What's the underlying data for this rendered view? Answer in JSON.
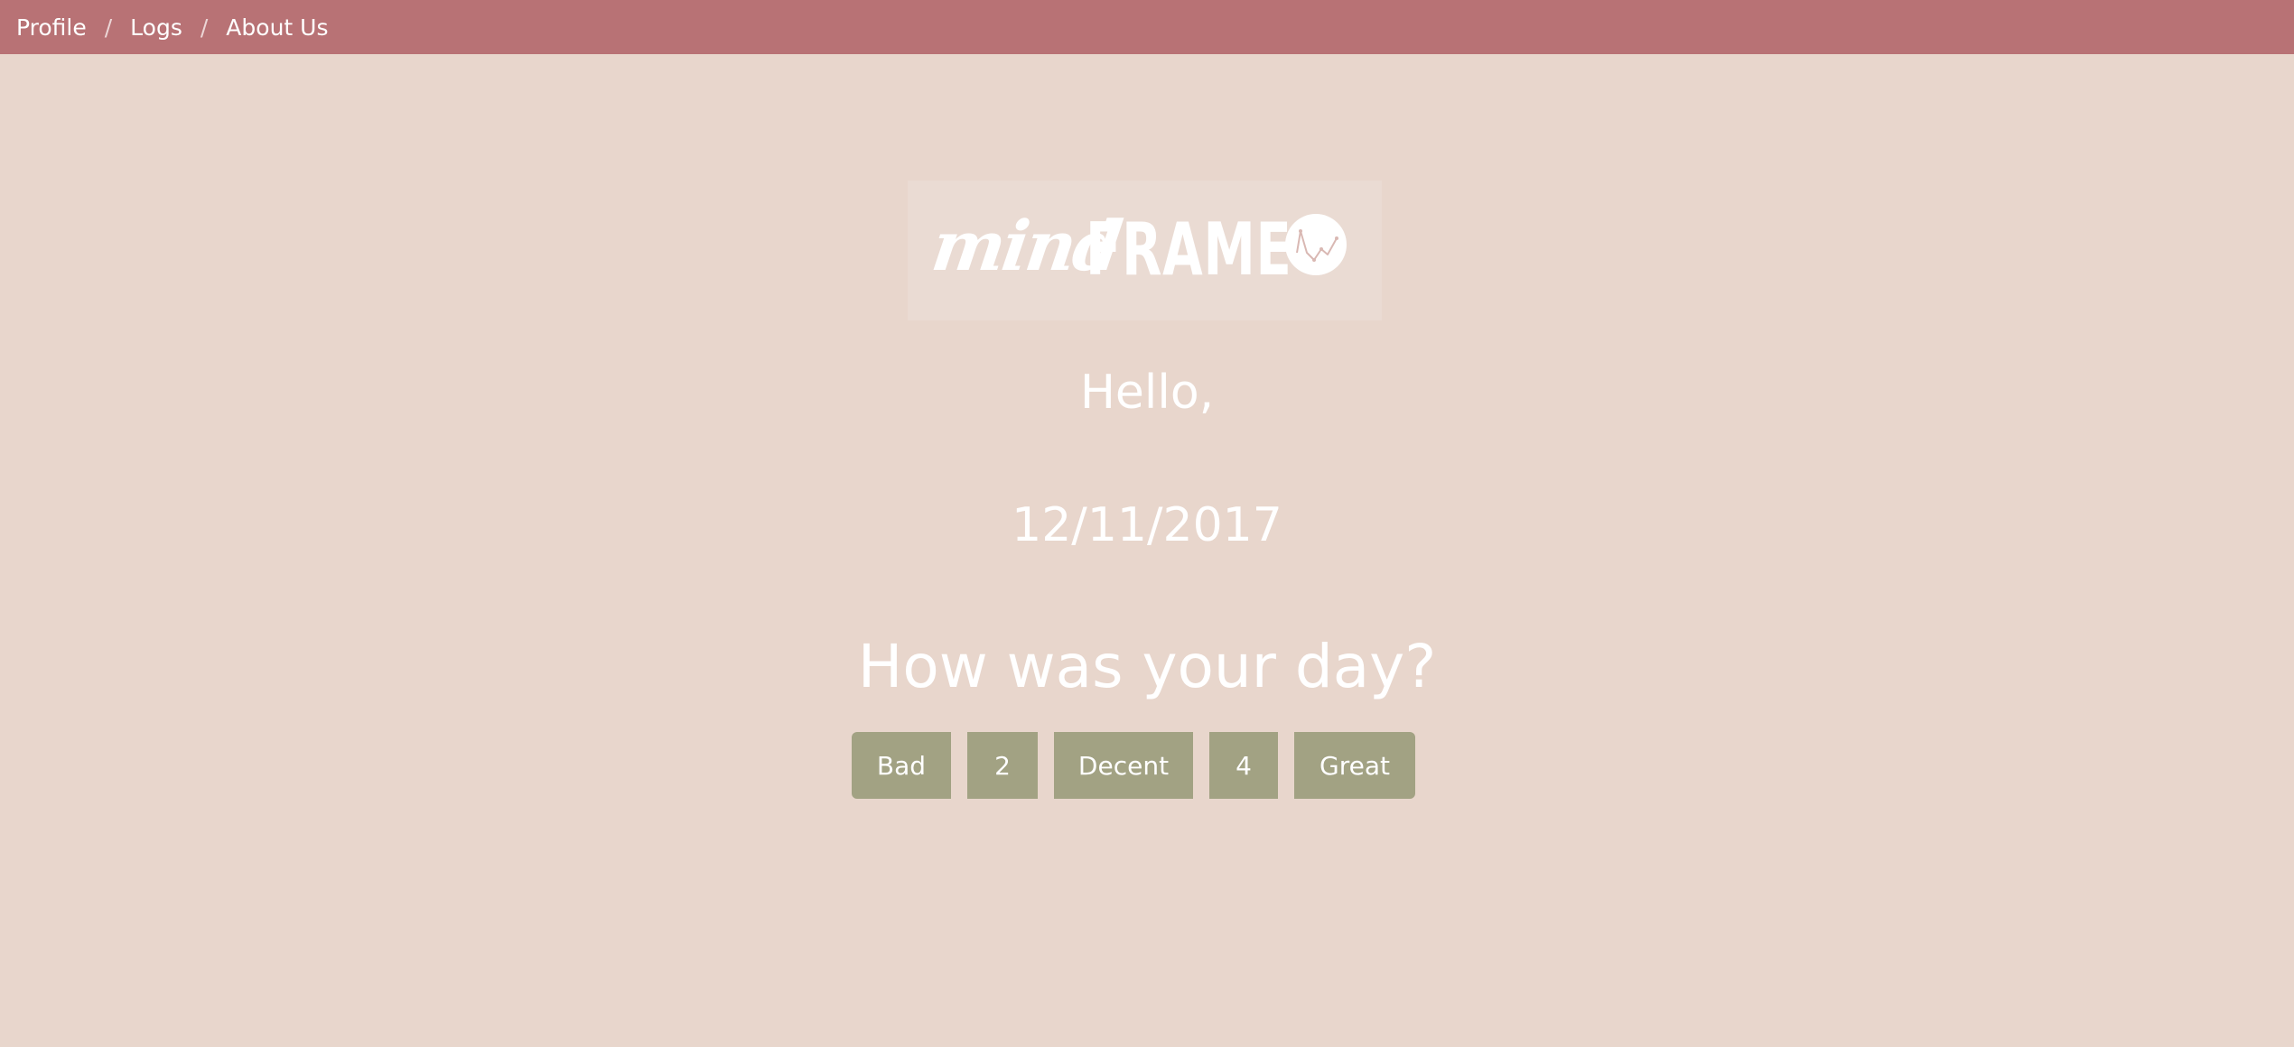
{
  "nav": {
    "items": [
      {
        "label": "Profile"
      },
      {
        "label": "Logs"
      },
      {
        "label": "About Us"
      }
    ],
    "separator": "/"
  },
  "logo": {
    "part1": "mind",
    "part2": "FRAME",
    "icon": "chart-check-circle-icon"
  },
  "greeting": "Hello,",
  "date": "12/11/2017",
  "question": "How was your day?",
  "rating_options": [
    {
      "label": "Bad"
    },
    {
      "label": "2"
    },
    {
      "label": "Decent"
    },
    {
      "label": "4"
    },
    {
      "label": "Great"
    }
  ],
  "colors": {
    "background": "#e8d6cc",
    "navbar": "#b87275",
    "button": "#a2a283",
    "text": "#ffffff"
  }
}
